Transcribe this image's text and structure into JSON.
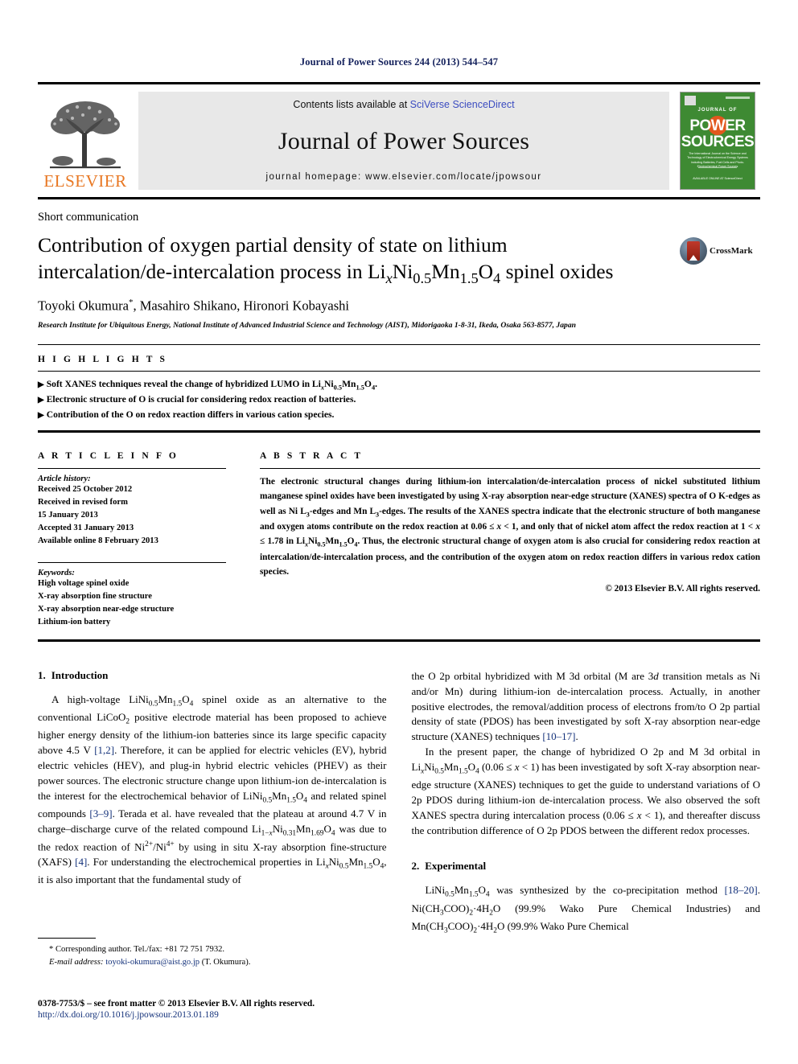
{
  "running_head": "Journal of Power Sources 244 (2013) 544–547",
  "masthead": {
    "publisher_logo_label": "ELSEVIER",
    "contents_prefix": "Contents lists available at ",
    "contents_link": "SciVerse ScienceDirect",
    "journal_title": "Journal of Power Sources",
    "homepage": "journal homepage: www.elsevier.com/locate/jpowsour",
    "cover": {
      "journal_of": "JOURNAL OF",
      "word1": "POWER",
      "word2": "SOURCES",
      "subtitle": "The International Journal on the Science and Technology of Electrochemical Energy Systems including Batteries, Fuel Cells and Photo-Electrochemical Power Sources",
      "footer": "AVAILABLE ONLINE AT\nScienceDirect"
    }
  },
  "article": {
    "type": "Short communication",
    "title_line1": "Contribution of oxygen partial density of state on lithium",
    "title_line2_pre": "intercalation/de-intercalation process in Li",
    "title_sub_x": "x",
    "title_ni": "Ni",
    "title_sub_05": "0.5",
    "title_mn": "Mn",
    "title_sub_15": "1.5",
    "title_o": "O",
    "title_sub_4": "4",
    "title_line2_post": " spinel oxides",
    "crossmark_label": "CrossMark",
    "authors": "Toyoki Okumura",
    "authors_star": "*",
    "authors_rest": ", Masahiro Shikano, Hironori Kobayashi",
    "affiliation": "Research Institute for Ubiquitous Energy, National Institute of Advanced Industrial Science and Technology (AIST), Midorigaoka 1-8-31, Ikeda, Osaka 563-8577, Japan"
  },
  "highlights": {
    "heading": "H I G H L I G H T S",
    "bullet_glyph": "▶",
    "items": [
      "Soft XANES techniques reveal the change of hybridized LUMO in LixNi0.5Mn1.5O4.",
      "Electronic structure of O is crucial for considering redox reaction of batteries.",
      "Contribution of the O on redox reaction differs in various cation species."
    ]
  },
  "article_info": {
    "heading": "A R T I C L E   I N F O",
    "history_label": "Article history:",
    "history": [
      "Received 25 October 2012",
      "Received in revised form",
      "15 January 2013",
      "Accepted 31 January 2013",
      "Available online 8 February 2013"
    ],
    "keywords_label": "Keywords:",
    "keywords": [
      "High voltage spinel oxide",
      "X-ray absorption fine structure",
      "X-ray absorption near-edge structure",
      "Lithium-ion battery"
    ]
  },
  "abstract": {
    "heading": "A B S T R A C T",
    "text": "The electronic structural changes during lithium-ion intercalation/de-intercalation process of nickel substituted lithium manganese spinel oxides have been investigated by using X-ray absorption near-edge structure (XANES) spectra of O K-edges as well as Ni L3-edges and Mn L3-edges. The results of the XANES spectra indicate that the electronic structure of both manganese and oxygen atoms contribute on the redox reaction at 0.06 ≤ x < 1, and only that of nickel atom affect the redox reaction at 1 < x ≤ 1.78 in LixNi0.5Mn1.5O4. Thus, the electronic structural change of oxygen atom is also crucial for considering redox reaction at intercalation/de-intercalation process, and the contribution of the oxygen atom on redox reaction differs in various redox cation species.",
    "copyright": "© 2013 Elsevier B.V. All rights reserved."
  },
  "body": {
    "section1": {
      "number": "1.",
      "title": "Introduction",
      "paragraph": "A high-voltage LiNi0.5Mn1.5O4 spinel oxide as an alternative to the conventional LiCoO2 positive electrode material has been proposed to achieve higher energy density of the lithium-ion batteries since its large specific capacity above 4.5 V [1,2]. Therefore, it can be applied for electric vehicles (EV), hybrid electric vehicles (HEV), and plug-in hybrid electric vehicles (PHEV) as their power sources. The electronic structure change upon lithium-ion de-intercalation is the interest for the electrochemical behavior of LiNi0.5Mn1.5O4 and related spinel compounds [3–9]. Terada et al. have revealed that the plateau at around 4.7 V in charge–discharge curve of the related compound Li1−xNi0.31Mn1.69O4 was due to the redox reaction of Ni2+/Ni4+ by using in situ X-ray absorption fine-structure (XAFS) [4]. For understanding the electrochemical properties in LixNi0.5Mn1.5O4, it is also important that the fundamental study of"
    },
    "right_para1": "the O 2p orbital hybridized with M 3d orbital (M are 3d transition metals as Ni and/or Mn) during lithium-ion de-intercalation process. Actually, in another positive electrodes, the removal/addition process of electrons from/to O 2p partial density of state (PDOS) has been investigated by soft X-ray absorption near-edge structure (XANES) techniques [10–17].",
    "right_para2": "In the present paper, the change of hybridized O 2p and M 3d orbital in LixNi0.5Mn1.5O4 (0.06 ≤ x < 1) has been investigated by soft X-ray absorption near-edge structure (XANES) techniques to get the guide to understand variations of O 2p PDOS during lithium-ion de-intercalation process. We also observed the soft XANES spectra during intercalation process (0.06 ≤ x < 1), and thereafter discuss the contribution difference of O 2p PDOS between the different redox processes.",
    "section2": {
      "number": "2.",
      "title": "Experimental",
      "paragraph": "LiNi0.5Mn1.5O4 was synthesized by the co-precipitation method [18–20]. Ni(CH3COO)2·4H2O (99.9% Wako Pure Chemical Industries) and Mn(CH3COO)2·4H2O (99.9% Wako Pure Chemical"
    }
  },
  "footnote": {
    "star": "*",
    "corresponding": "Corresponding author. Tel./fax: +81 72 751 7932.",
    "email_label": "E-mail address:",
    "email": "toyoki-okumura@aist.go.jp",
    "email_suffix": " (T. Okumura)."
  },
  "colophon": {
    "line1": "0378-7753/$ – see front matter © 2013 Elsevier B.V. All rights reserved.",
    "line2": "http://dx.doi.org/10.1016/j.jpowsour.2013.01.189"
  }
}
